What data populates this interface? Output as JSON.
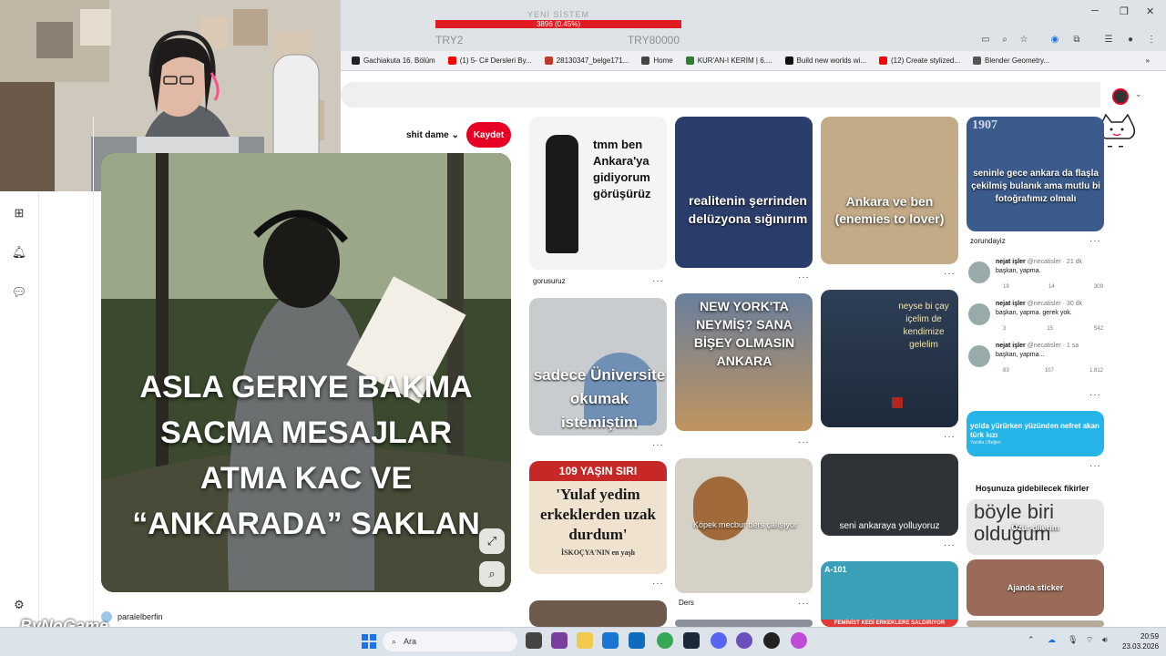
{
  "stream": {
    "title": "YENİ SİSTEM",
    "progress_text": "3896 (0.45%)",
    "left_label": "TRY2",
    "right_label": "TRY80000"
  },
  "bookmarks": [
    {
      "label": "Gachiakuta 16. Bölüm",
      "color": "#222222"
    },
    {
      "label": "(1) 5- C# Dersleri By...",
      "color": "#ff0000"
    },
    {
      "label": "28130347_belge171...",
      "color": "#c0392b"
    },
    {
      "label": "Home",
      "color": "#444444"
    },
    {
      "label": "KUR'AN-I KERİM | 6....",
      "color": "#2e7d32"
    },
    {
      "label": "Build new worlds wi...",
      "color": "#111111"
    },
    {
      "label": "(12) Create stylized...",
      "color": "#ff0000"
    },
    {
      "label": "Blender Geometry...",
      "color": "#555555"
    }
  ],
  "pin": {
    "board": "shit dame",
    "save_label": "Kaydet",
    "overlay_text": [
      "ASLA GERIYE BAKMA",
      "SACMA MESAJLAR",
      "ATMA KAC VE",
      "“ANKARADA” SAKLAN"
    ],
    "author": "paralelberfin"
  },
  "grid": {
    "col1": [
      {
        "text": "tmm ben Ankara'ya gidiyorum görüşürüz",
        "label": "gorusuruz"
      },
      {
        "text": "sadece Üniversite okumak istemiştim",
        "label": ""
      },
      {
        "text": "'Yulaf yedim erkeklerden uzak durdum'",
        "top": "109 YAŞIN SIRI",
        "sub": "İSKOÇYA'NIN en yaşlı"
      }
    ],
    "col2": [
      {
        "text": "realitenin şerrinden delüzyona sığınırım",
        "label": ""
      },
      {
        "text": "NEW YORK'TA NEYMİŞ? SANA BİŞEY OLMASIN ANKARA",
        "label": ""
      },
      {
        "text": "Köpek mecbur ders çalışıyor",
        "label": "Ders"
      }
    ],
    "col3": [
      {
        "text": "Ankara ve ben (enemies to lover)",
        "label": ""
      },
      {
        "text": "neyse bi çay içelim de kendimize gelelim",
        "label": ""
      },
      {
        "text": "seni ankaraya yolluyoruz",
        "label": ""
      },
      {
        "text": "A-101",
        "sub": "FEMİNİST KEDİ ERKEKLERE SALDIRIYOR"
      }
    ],
    "col4": [
      {
        "text": "seninle gece ankara da flaşla çekilmiş bulanık ama mutlu bi fotoğrafımız olmalı",
        "label": "zorundayiz",
        "year": "1907"
      },
      {
        "tweets": [
          {
            "name": "nejat işler",
            "handle": "@necatisler · 21 dk",
            "body": "başkan, yapma.",
            "stats": [
              "19",
              "14",
              "309"
            ]
          },
          {
            "name": "nejat işler",
            "handle": "@necatisler · 30 dk",
            "body": "başkan, yapma. gerek yok.",
            "stats": [
              "3",
              "15",
              "542"
            ]
          },
          {
            "name": "nejat işler",
            "handle": "@necatisler · 1 sa",
            "body": "başkan, yapma...",
            "stats": [
              "83",
              "107",
              "1.812"
            ]
          }
        ]
      },
      {
        "text": "yolda yürürken yüzünden nefret akan türk kızı",
        "sub": "Yanıtla | Beğen"
      },
      {
        "heading": "Hoşunuza gidebilecek fikirler"
      },
      {
        "text": "böyle biri olduğum",
        "caption": "Özür dilerim"
      },
      {
        "text": "Ajanda sticker"
      }
    ]
  },
  "taskbar": {
    "search_placeholder": "Ara",
    "time": "20:59",
    "date": "23.03.2026"
  },
  "watermark": "ByNoGame"
}
